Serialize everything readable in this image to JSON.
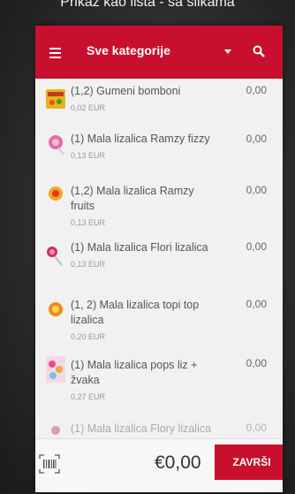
{
  "caption": "Prikaz kao lista - sa slikama",
  "header": {
    "title": "Sve kategorije"
  },
  "items": [
    {
      "name": "(1,2) Gumeni bomboni",
      "price": "0,02 EUR",
      "qty": "0,00"
    },
    {
      "name": "(1) Mala lizalica Ramzy fizzy",
      "price": "0,13 EUR",
      "qty": "0,00"
    },
    {
      "name": "(1,2) Mala lizalica Ramzy fruits",
      "price": "0,13 EUR",
      "qty": "0,00"
    },
    {
      "name": "(1) Mala lizalica Flori lizalica",
      "price": "0,13 EUR",
      "qty": "0,00"
    },
    {
      "name": "(1, 2) Mala lizalica topi top lizalica",
      "price": "0,20 EUR",
      "qty": "0,00"
    },
    {
      "name": "(1) Mala lizalica pops liz + žvaka",
      "price": "0,27 EUR",
      "qty": "0,00"
    },
    {
      "name": "(1) Mala lizalica Flory lizalica",
      "price": "",
      "qty": "0,00"
    }
  ],
  "footer": {
    "total": "€0,00",
    "finish_label": "ZAVRŠI"
  },
  "colors": {
    "accent": "#c8102e"
  }
}
